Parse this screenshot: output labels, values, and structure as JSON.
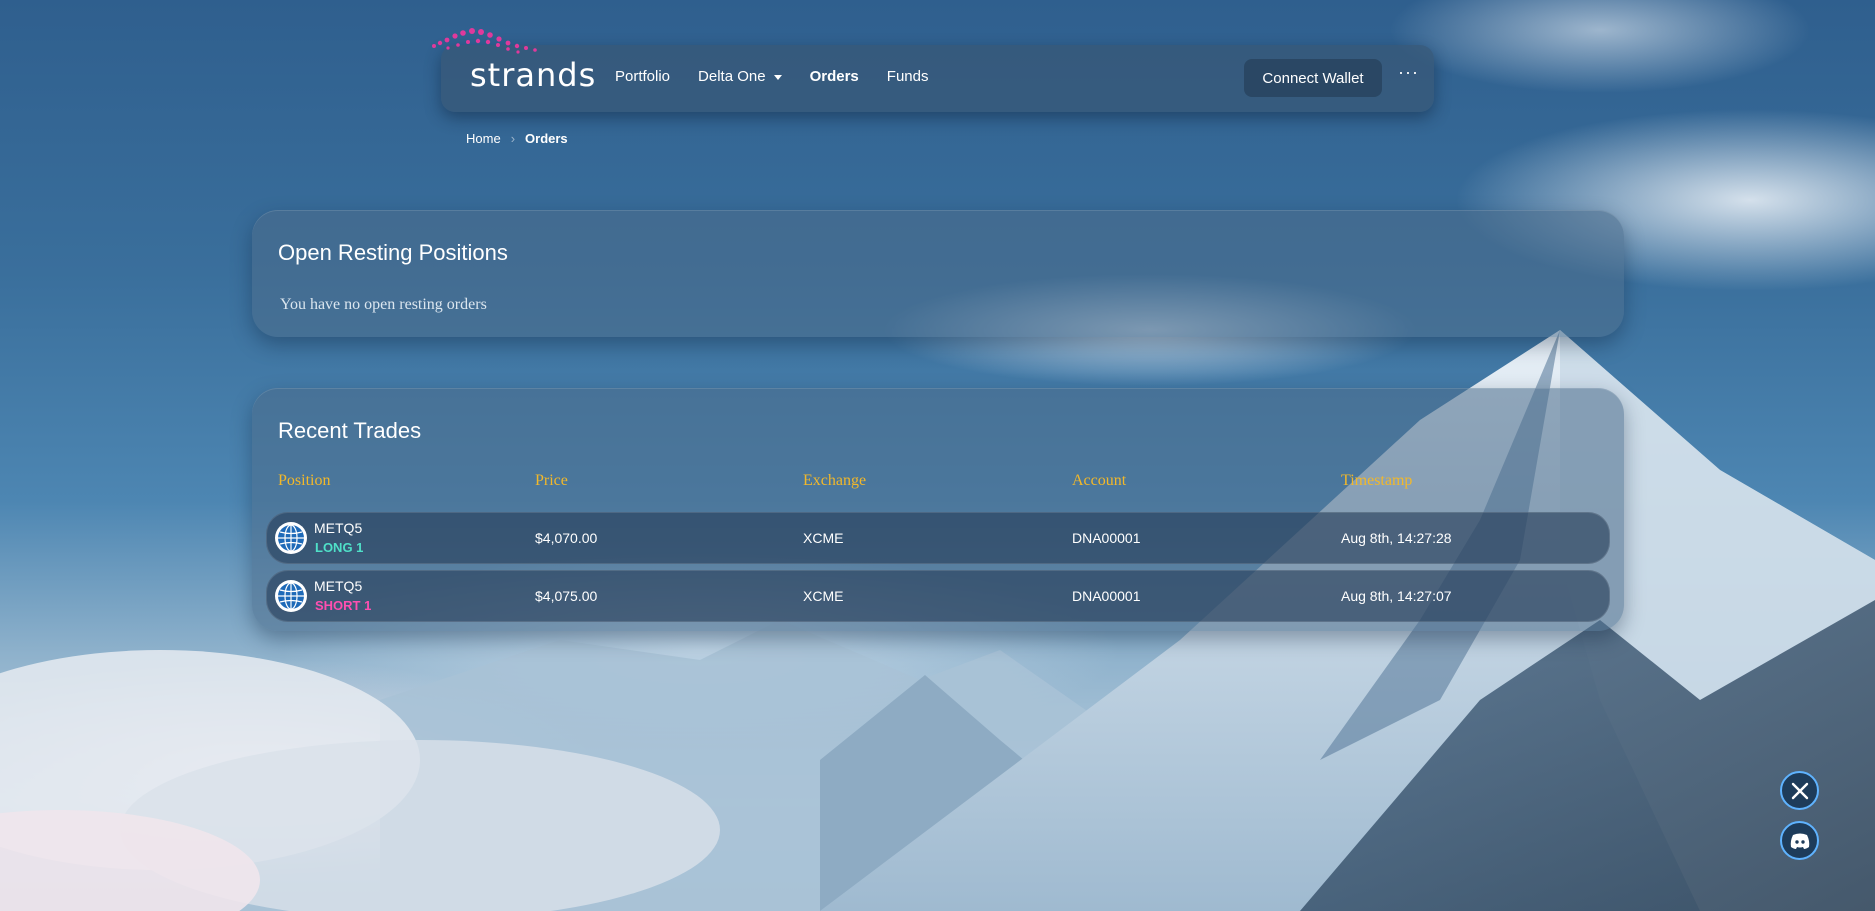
{
  "app": {
    "name": "strands"
  },
  "nav": {
    "items": [
      {
        "label": "Portfolio",
        "active": false
      },
      {
        "label": "Delta One",
        "active": false,
        "dropdown": true
      },
      {
        "label": "Orders",
        "active": true
      },
      {
        "label": "Funds",
        "active": false
      }
    ],
    "connect_wallet": "Connect Wallet",
    "more": "···"
  },
  "breadcrumb": {
    "home": "Home",
    "current": "Orders"
  },
  "open_positions": {
    "title": "Open Resting Positions",
    "empty_message": "You have no open resting orders"
  },
  "recent_trades": {
    "title": "Recent Trades",
    "columns": [
      "Position",
      "Price",
      "Exchange",
      "Account",
      "Timestamp"
    ],
    "rows": [
      {
        "symbol": "METQ5",
        "side": "LONG 1",
        "side_type": "long",
        "price": "$4,070.00",
        "exchange": "XCME",
        "account": "DNA00001",
        "timestamp": "Aug 8th, 14:27:28"
      },
      {
        "symbol": "METQ5",
        "side": "SHORT 1",
        "side_type": "short",
        "price": "$4,075.00",
        "exchange": "XCME",
        "account": "DNA00001",
        "timestamp": "Aug 8th, 14:27:07"
      }
    ]
  },
  "social": {
    "x_icon": "x-icon",
    "discord_icon": "discord-icon"
  },
  "colors": {
    "accent_header": "#f2b82a",
    "long": "#4fe0c8",
    "short": "#ff4fb0",
    "logo_pink": "#e0399c"
  }
}
